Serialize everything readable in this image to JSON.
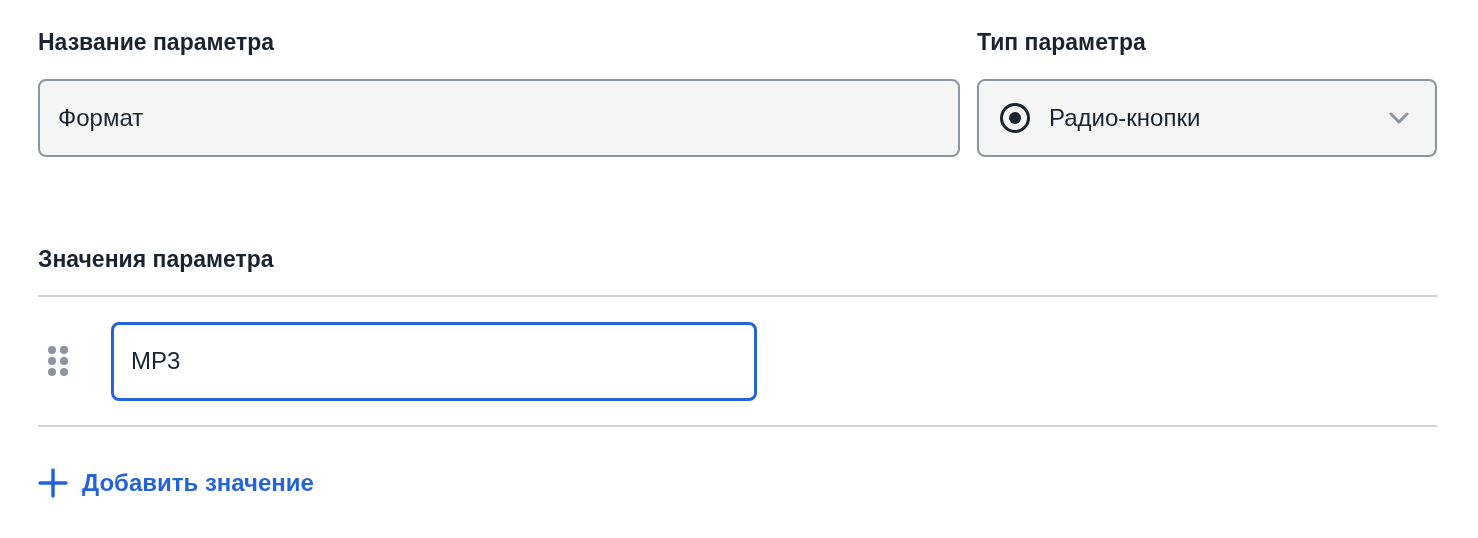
{
  "name_field": {
    "label": "Название параметра",
    "value": "Формат"
  },
  "type_field": {
    "label": "Тип параметра",
    "value": "Радио-кнопки"
  },
  "values_section": {
    "title": "Значения параметра",
    "values": [
      {
        "value": "MP3",
        "focused": true
      }
    ]
  },
  "add_button": {
    "label": "Добавить значение"
  }
}
